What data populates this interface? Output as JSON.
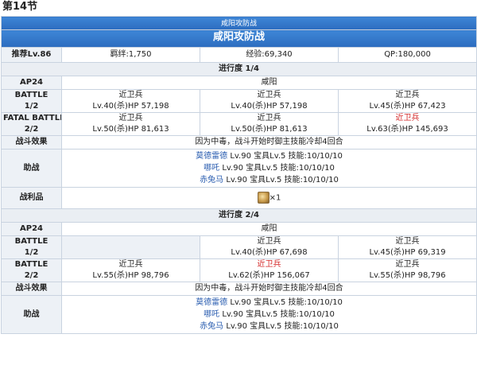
{
  "section_title": "第14节",
  "banner": {
    "subtitle": "咸阳攻防战",
    "title": "咸阳攻防战"
  },
  "info": {
    "level": "推荐Lv.86",
    "bond": "羁绊:1,750",
    "exp": "经验:69,340",
    "qp": "QP:180,000"
  },
  "progress1": {
    "label": "进行度 1/4",
    "ap": "AP24",
    "location": "咸阳",
    "battle1": {
      "label_top": "BATTLE",
      "label_bottom": "1/2",
      "enemies": [
        {
          "name": "近卫兵",
          "stats": "Lv.40(杀)HP 57,198",
          "red": false
        },
        {
          "name": "近卫兵",
          "stats": "Lv.40(杀)HP 57,198",
          "red": false
        },
        {
          "name": "近卫兵",
          "stats": "Lv.45(杀)HP 67,423",
          "red": false
        }
      ]
    },
    "battle2": {
      "label_top": "FATAL BATTLE",
      "label_bottom": "2/2",
      "enemies": [
        {
          "name": "近卫兵",
          "stats": "Lv.50(杀)HP 81,613",
          "red": false
        },
        {
          "name": "近卫兵",
          "stats": "Lv.50(杀)HP 81,613",
          "red": false
        },
        {
          "name": "近卫兵",
          "stats": "Lv.63(杀)HP 145,693",
          "red": true
        }
      ]
    },
    "effect_label": "战斗效果",
    "effect_text": "因为中毒，战斗开始时御主技能冷却4回合",
    "support_label": "助战",
    "support": [
      {
        "name": "莫德雷德",
        "detail": " Lv.90 宝具Lv.5 技能:10/10/10"
      },
      {
        "name": "哪吒",
        "detail": " Lv.90 宝具Lv.5 技能:10/10/10"
      },
      {
        "name": "赤兔马",
        "detail": " Lv.90 宝具Lv.5 技能:10/10/10"
      }
    ],
    "loot_label": "战利品",
    "loot_count": "×1"
  },
  "progress2": {
    "label": "进行度 2/4",
    "ap": "AP24",
    "location": "咸阳",
    "battle1": {
      "label_top": "BATTLE",
      "label_bottom": "1/2",
      "enemies": [
        {
          "name": "近卫兵",
          "stats": "Lv.40(杀)HP 67,698",
          "red": false
        },
        {
          "name": "近卫兵",
          "stats": "Lv.45(杀)HP 69,319",
          "red": false
        }
      ]
    },
    "battle2": {
      "label_top": "BATTLE",
      "label_bottom": "2/2",
      "enemies": [
        {
          "name": "近卫兵",
          "stats": "Lv.55(杀)HP 98,796",
          "red": false
        },
        {
          "name": "近卫兵",
          "stats": "Lv.62(杀)HP 156,067",
          "red": true
        },
        {
          "name": "近卫兵",
          "stats": "Lv.55(杀)HP 98,796",
          "red": false
        }
      ]
    },
    "effect_label": "战斗效果",
    "effect_text": "因为中毒，战斗开始时御主技能冷却4回合",
    "support_label": "助战",
    "support": [
      {
        "name": "莫德雷德",
        "detail": " Lv.90 宝具Lv.5 技能:10/10/10"
      },
      {
        "name": "哪吒",
        "detail": " Lv.90 宝具Lv.5 技能:10/10/10"
      },
      {
        "name": "赤兔马",
        "detail": " Lv.90 宝具Lv.5 技能:10/10/10"
      }
    ]
  }
}
